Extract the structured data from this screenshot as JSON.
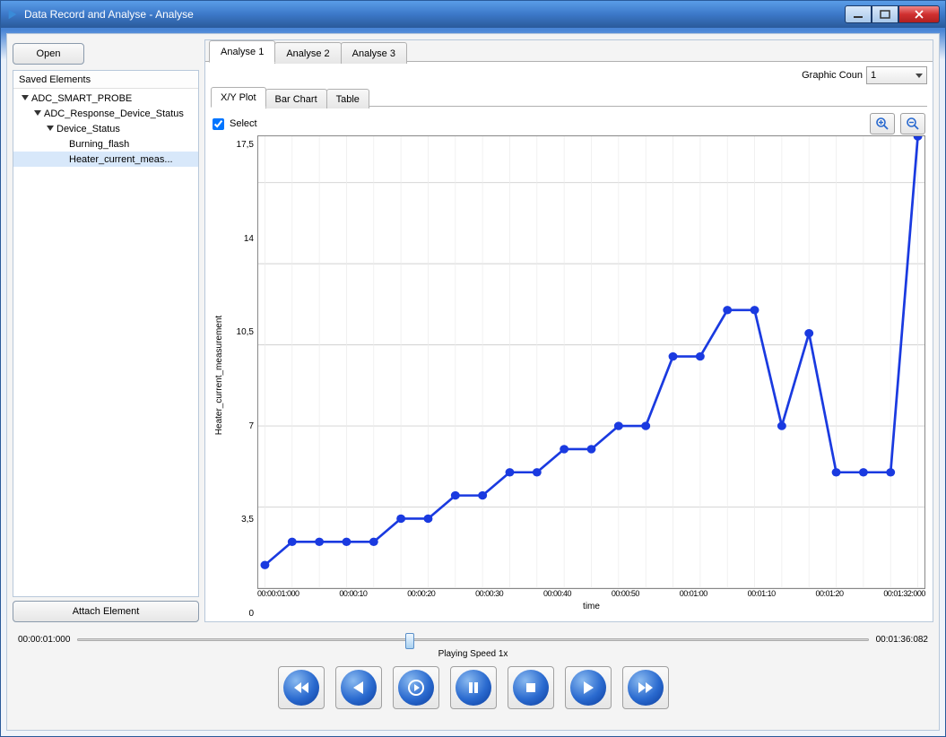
{
  "window": {
    "title": "Data Record and Analyse - Analyse"
  },
  "sidebar": {
    "open_label": "Open",
    "panel_title": "Saved Elements",
    "attach_label": "Attach Element",
    "tree": [
      {
        "label": "ADC_SMART_PROBE",
        "indent": 0,
        "expanded": true
      },
      {
        "label": "ADC_Response_Device_Status",
        "indent": 1,
        "expanded": true
      },
      {
        "label": "Device_Status",
        "indent": 2,
        "expanded": true
      },
      {
        "label": "Burning_flash",
        "indent": 3,
        "expanded": false,
        "leaf": true
      },
      {
        "label": "Heater_current_meas...",
        "indent": 3,
        "expanded": false,
        "leaf": true,
        "selected": true
      }
    ]
  },
  "main": {
    "tabs": [
      {
        "label": "Analyse 1",
        "active": true
      },
      {
        "label": "Analyse 2"
      },
      {
        "label": "Analyse 3"
      }
    ],
    "graphic_count_label": "Graphic Coun",
    "graphic_count_value": "1",
    "subtabs": [
      {
        "label": "X/Y Plot",
        "active": true
      },
      {
        "label": "Bar Chart"
      },
      {
        "label": "Table"
      }
    ],
    "select_label": "Select",
    "select_checked": true
  },
  "chart_data": {
    "type": "line",
    "ylabel": "Heater_current_measurement",
    "xlabel": "time",
    "y_ticks": [
      0,
      3.5,
      7,
      10.5,
      14,
      17.5
    ],
    "ylim": [
      0,
      19.5
    ],
    "x_ticks_display": "00:00:01:000 … 00:01:32:000 (dense overlapping tick labels)",
    "points": [
      {
        "i": 0,
        "y": 1.0
      },
      {
        "i": 1,
        "y": 2.0
      },
      {
        "i": 2,
        "y": 2.0
      },
      {
        "i": 3,
        "y": 2.0
      },
      {
        "i": 4,
        "y": 2.0
      },
      {
        "i": 5,
        "y": 3.0
      },
      {
        "i": 6,
        "y": 3.0
      },
      {
        "i": 7,
        "y": 4.0
      },
      {
        "i": 8,
        "y": 4.0
      },
      {
        "i": 9,
        "y": 5.0
      },
      {
        "i": 10,
        "y": 5.0
      },
      {
        "i": 11,
        "y": 6.0
      },
      {
        "i": 12,
        "y": 6.0
      },
      {
        "i": 13,
        "y": 7.0
      },
      {
        "i": 14,
        "y": 7.0
      },
      {
        "i": 15,
        "y": 10.0
      },
      {
        "i": 16,
        "y": 10.0
      },
      {
        "i": 17,
        "y": 12.0
      },
      {
        "i": 18,
        "y": 12.0
      },
      {
        "i": 19,
        "y": 7.0
      },
      {
        "i": 20,
        "y": 11.0
      },
      {
        "i": 21,
        "y": 5.0
      },
      {
        "i": 22,
        "y": 5.0
      },
      {
        "i": 23,
        "y": 5.0
      },
      {
        "i": 24,
        "y": 19.5
      }
    ]
  },
  "transport": {
    "time_start": "00:00:01:000",
    "time_end": "00:01:36:082",
    "slider_pct": 42,
    "speed_label": "Playing Speed  1x"
  }
}
